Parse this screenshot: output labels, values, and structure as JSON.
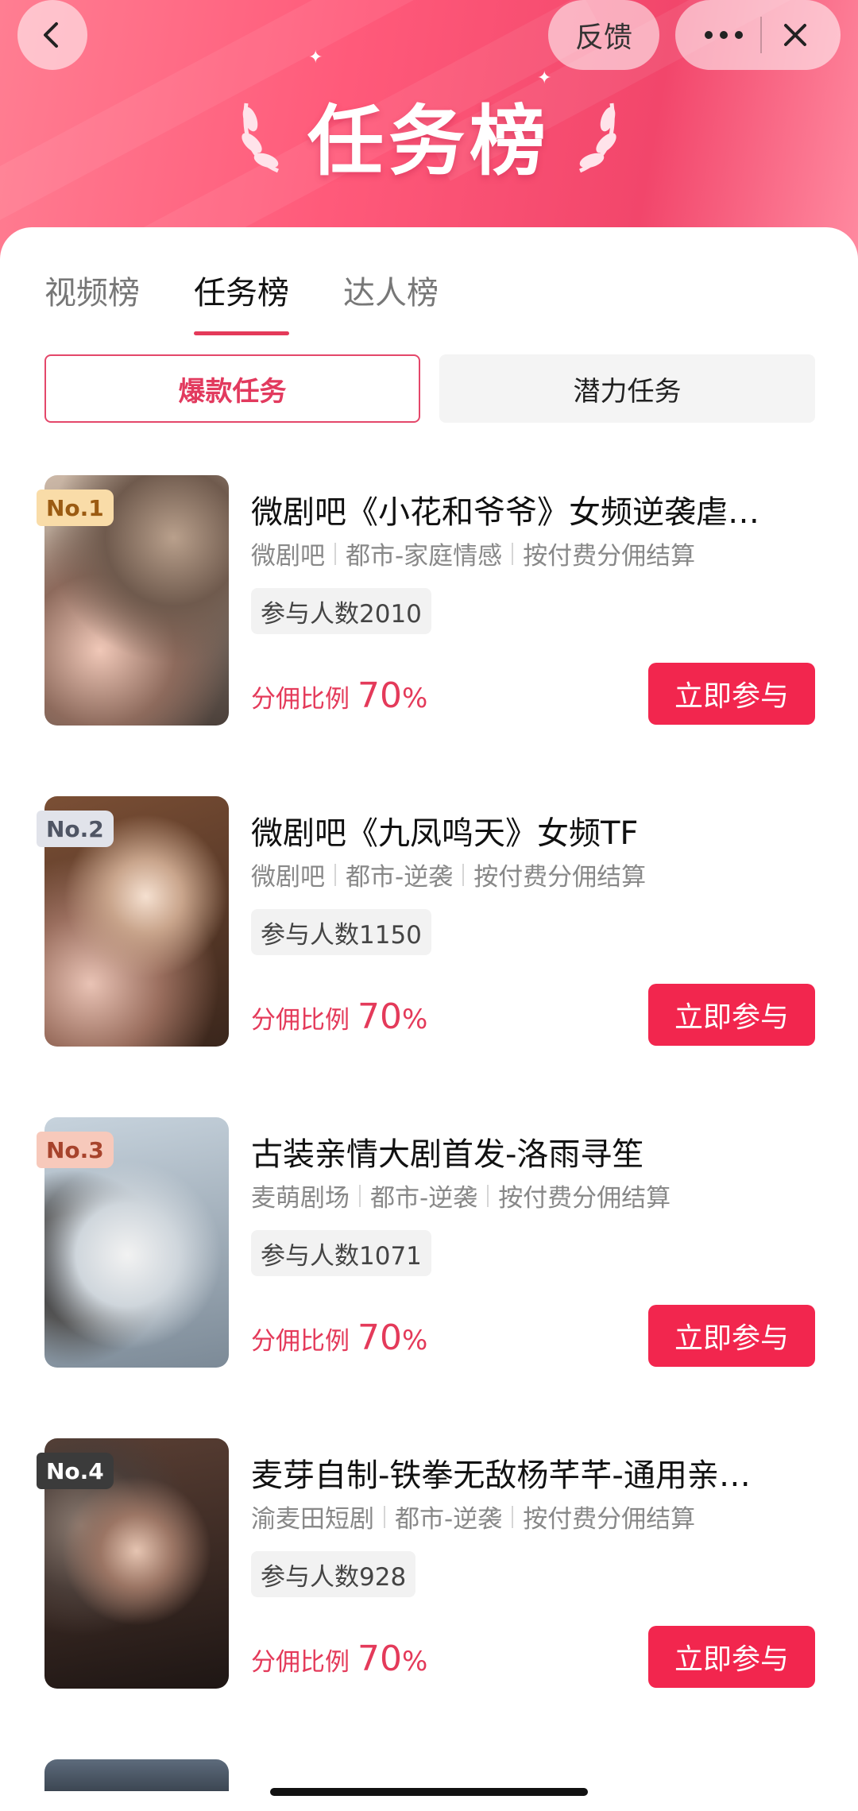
{
  "header": {
    "back_icon": "chevron-left-icon",
    "feedback_label": "反馈",
    "more_icon": "more-dots-icon",
    "close_icon": "close-icon",
    "banner_title": "任务榜"
  },
  "tabs": [
    {
      "label": "视频榜",
      "active": false
    },
    {
      "label": "任务榜",
      "active": true
    },
    {
      "label": "达人榜",
      "active": false
    }
  ],
  "segments": {
    "hot_label": "爆款任务",
    "potential_label": "潜力任务"
  },
  "items": [
    {
      "rank": "No.1",
      "title": "微剧吧《小花和爷爷》女频逆袭虐…",
      "source": "微剧吧",
      "category": "都市-家庭情感",
      "settlement": "按付费分佣结算",
      "participants": "参与人数2010",
      "ratio_label": "分佣比例",
      "ratio_value": "70",
      "ratio_unit": "%",
      "action": "立即参与"
    },
    {
      "rank": "No.2",
      "title": "微剧吧《九凤鸣天》女频TF",
      "source": "微剧吧",
      "category": "都市-逆袭",
      "settlement": "按付费分佣结算",
      "participants": "参与人数1150",
      "ratio_label": "分佣比例",
      "ratio_value": "70",
      "ratio_unit": "%",
      "action": "立即参与"
    },
    {
      "rank": "No.3",
      "title": "古装亲情大剧首发-洛雨寻笙",
      "source": "麦萌剧场",
      "category": "都市-逆袭",
      "settlement": "按付费分佣结算",
      "participants": "参与人数1071",
      "ratio_label": "分佣比例",
      "ratio_value": "70",
      "ratio_unit": "%",
      "action": "立即参与"
    },
    {
      "rank": "No.4",
      "title": "麦芽自制-铁拳无敌杨芊芊-通用亲…",
      "source": "渝麦田短剧",
      "category": "都市-逆袭",
      "settlement": "按付费分佣结算",
      "participants": "参与人数928",
      "ratio_label": "分佣比例",
      "ratio_value": "70",
      "ratio_unit": "%",
      "action": "立即参与"
    }
  ]
}
